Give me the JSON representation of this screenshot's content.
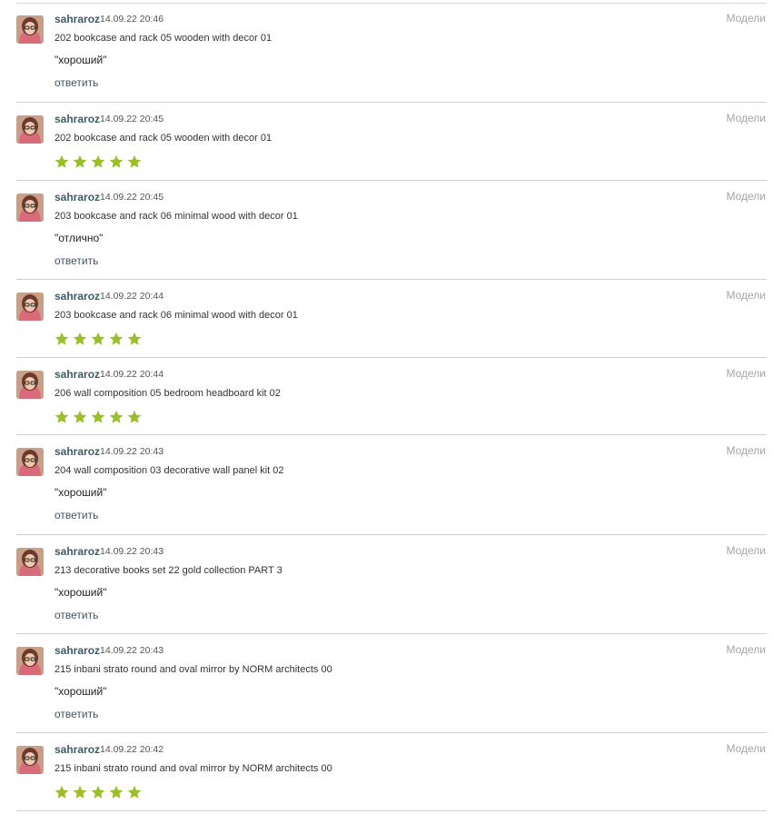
{
  "comments": [
    {
      "user": "sahraroz",
      "time": "14.09.22 20:46",
      "category": "Модели",
      "model": "202 bookcase and rack 05 wooden with decor 01",
      "type": "text",
      "text": "\"хороший\"",
      "reply": "ответить"
    },
    {
      "user": "sahraroz",
      "time": "14.09.22 20:45",
      "category": "Модели",
      "model": "202 bookcase and rack 05 wooden with decor 01",
      "type": "rating",
      "rating": 5
    },
    {
      "user": "sahraroz",
      "time": "14.09.22 20:45",
      "category": "Модели",
      "model": "203 bookcase and rack 06 minimal wood with decor 01",
      "type": "text",
      "text": "\"отлично\"",
      "reply": "ответить"
    },
    {
      "user": "sahraroz",
      "time": "14.09.22 20:44",
      "category": "Модели",
      "model": "203 bookcase and rack 06 minimal wood with decor 01",
      "type": "rating",
      "rating": 5
    },
    {
      "user": "sahraroz",
      "time": "14.09.22 20:44",
      "category": "Модели",
      "model": "206 wall composition 05 bedroom headboard kit 02",
      "type": "rating",
      "rating": 5
    },
    {
      "user": "sahraroz",
      "time": "14.09.22 20:43",
      "category": "Модели",
      "model": "204 wall composition 03 decorative wall panel kit 02",
      "type": "text",
      "text": "\"хороший\"",
      "reply": "ответить"
    },
    {
      "user": "sahraroz",
      "time": "14.09.22 20:43",
      "category": "Модели",
      "model": "213 decorative books set 22 gold collection PART 3",
      "type": "text",
      "text": "\"хороший\"",
      "reply": "ответить"
    },
    {
      "user": "sahraroz",
      "time": "14.09.22 20:43",
      "category": "Модели",
      "model": "215 inbani strato round and oval mirror by NORM architects 00",
      "type": "text",
      "text": "\"хороший\"",
      "reply": "ответить"
    },
    {
      "user": "sahraroz",
      "time": "14.09.22 20:42",
      "category": "Модели",
      "model": "215 inbani strato round and oval mirror by NORM architects 00",
      "type": "rating",
      "rating": 5
    }
  ],
  "colors": {
    "star": "#9bbf2a",
    "username": "#3e5a66",
    "category": "#a5a5a5",
    "divider": "#cfcfcf"
  }
}
